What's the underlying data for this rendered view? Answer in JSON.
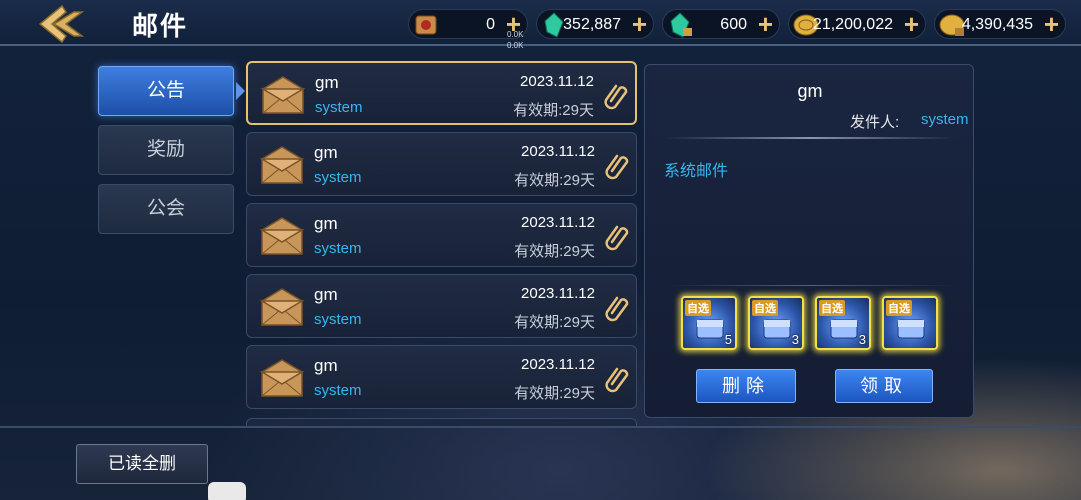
{
  "header": {
    "title": "邮件",
    "resources": [
      {
        "name": "scroll-icon",
        "value": "0"
      },
      {
        "name": "green-crystal-icon",
        "value": "352,887"
      },
      {
        "name": "locked-crystal-icon",
        "value": "600"
      },
      {
        "name": "gold-coin-icon",
        "value": "21,200,022"
      },
      {
        "name": "locked-coin-icon",
        "value": "4,390,435"
      }
    ],
    "net_up": "0.0K",
    "net_down": "0.0K"
  },
  "tabs": [
    {
      "label": "公告",
      "active": true
    },
    {
      "label": "奖励",
      "active": false
    },
    {
      "label": "公会",
      "active": false
    }
  ],
  "mails": [
    {
      "subject": "gm",
      "sender": "system",
      "date": "2023.11.12",
      "expiry": "有效期:29天",
      "selected": true
    },
    {
      "subject": "gm",
      "sender": "system",
      "date": "2023.11.12",
      "expiry": "有效期:29天",
      "selected": false
    },
    {
      "subject": "gm",
      "sender": "system",
      "date": "2023.11.12",
      "expiry": "有效期:29天",
      "selected": false
    },
    {
      "subject": "gm",
      "sender": "system",
      "date": "2023.11.12",
      "expiry": "有效期:29天",
      "selected": false
    },
    {
      "subject": "gm",
      "sender": "system",
      "date": "2023.11.12",
      "expiry": "有效期:29天",
      "selected": false
    }
  ],
  "detail": {
    "subject": "gm",
    "sender_label": "发件人:",
    "sender": "system",
    "body": "系统邮件",
    "attachments": [
      {
        "tag": "自选",
        "count": "5"
      },
      {
        "tag": "自选",
        "count": "3"
      },
      {
        "tag": "自选",
        "count": "3"
      },
      {
        "tag": "自选",
        "count": ""
      }
    ],
    "delete_label": "删除",
    "claim_label": "领取"
  },
  "footer": {
    "read_delete_label": "已读全删"
  },
  "colors": {
    "accent_blue": "#37b6f0",
    "gold": "#e6c26a",
    "button_blue": "#2a6fdd"
  }
}
